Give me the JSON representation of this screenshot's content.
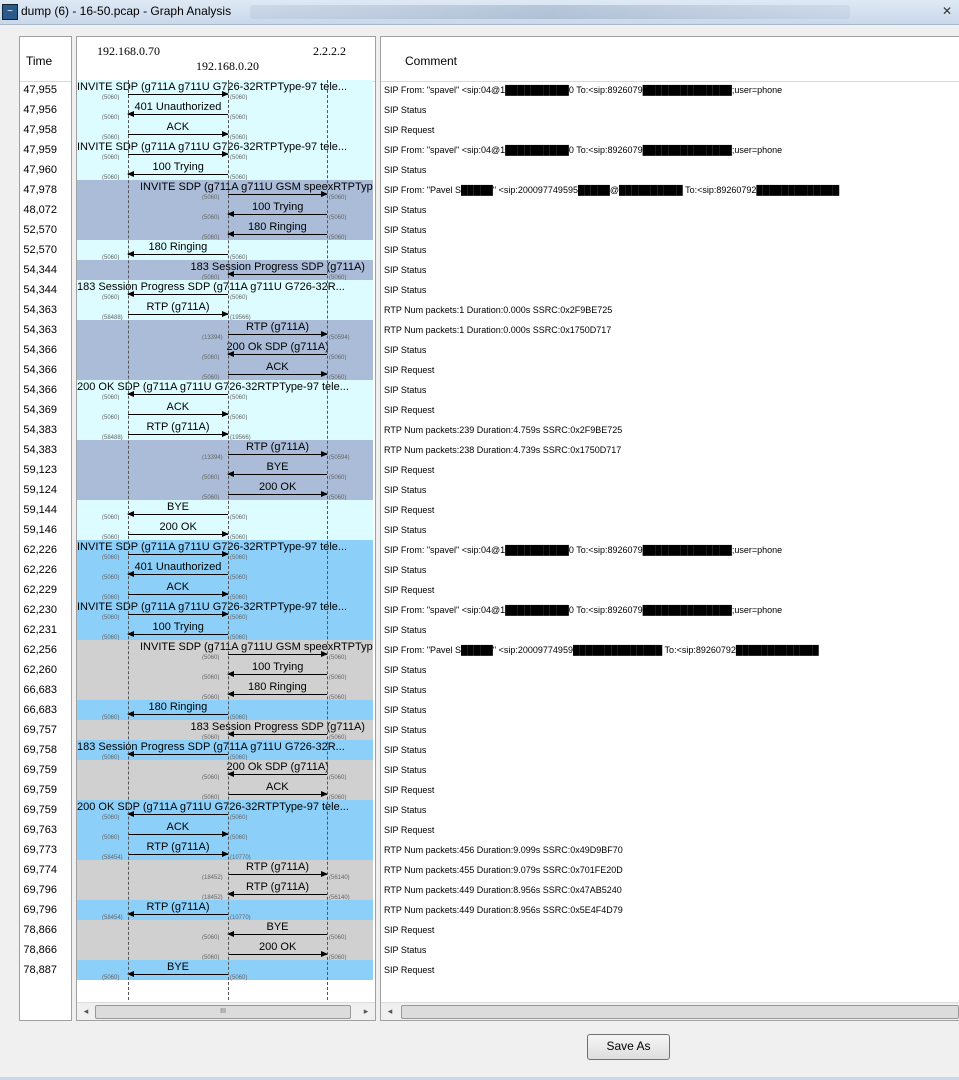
{
  "window": {
    "title": "dump (6) - 16-50.pcap - Graph Analysis",
    "app_icon": "wireshark-icon"
  },
  "columns": {
    "time": "Time",
    "comment": "Comment"
  },
  "nodes": [
    {
      "label": "192.168.0.70"
    },
    {
      "label": "192.168.0.20"
    },
    {
      "label": "2.2.2.2"
    }
  ],
  "colors": {
    "cyan": "#dcfcff",
    "slate": "#aabcd8",
    "sky": "#8cd0fa",
    "gray": "#d0d0d0"
  },
  "rows": [
    {
      "time": "47,955",
      "label": "INVITE SDP (g711A g711U G726-32RTPType-97 tele...",
      "from": 0,
      "to": 1,
      "band": "cyan",
      "p1": "(5060)",
      "p2": "(5060)",
      "comment": "SIP From: \"spavel\" <sip:04@1██████████0 To:<sip:8926079██████████████;user=phone"
    },
    {
      "time": "47,956",
      "label": "401 Unauthorized",
      "from": 1,
      "to": 0,
      "band": "cyan",
      "p1": "(5060)",
      "p2": "(5060)",
      "comment": "SIP Status"
    },
    {
      "time": "47,958",
      "label": "ACK",
      "from": 0,
      "to": 1,
      "band": "cyan",
      "p1": "(5060)",
      "p2": "(5060)",
      "comment": "SIP Request"
    },
    {
      "time": "47,959",
      "label": "INVITE SDP (g711A g711U G726-32RTPType-97 tele...",
      "from": 0,
      "to": 1,
      "band": "cyan",
      "p1": "(5060)",
      "p2": "(5060)",
      "comment": "SIP From: \"spavel\" <sip:04@1██████████0 To:<sip:8926079██████████████;user=phone"
    },
    {
      "time": "47,960",
      "label": "100 Trying",
      "from": 1,
      "to": 0,
      "band": "cyan",
      "p1": "(5060)",
      "p2": "(5060)",
      "comment": "SIP Status"
    },
    {
      "time": "47,978",
      "label": "INVITE SDP (g711A g711U GSM speexRTPTyp",
      "from": 1,
      "to": 2,
      "band": "slate",
      "p1": "(5060)",
      "p2": "(5060)",
      "comment": "SIP From: \"Pavel S█████\" <sip:200097749595█████@██████████ To:<sip:89260792█████████████"
    },
    {
      "time": "48,072",
      "label": "100 Trying",
      "from": 2,
      "to": 1,
      "band": "slate",
      "p1": "(5060)",
      "p2": "(5060)",
      "comment": "SIP Status"
    },
    {
      "time": "52,570",
      "label": "180 Ringing",
      "from": 2,
      "to": 1,
      "band": "slate",
      "p1": "(5060)",
      "p2": "(5060)",
      "comment": "SIP Status"
    },
    {
      "time": "52,570",
      "label": "180 Ringing",
      "from": 1,
      "to": 0,
      "band": "cyan",
      "p1": "(5060)",
      "p2": "(5060)",
      "comment": "SIP Status"
    },
    {
      "time": "54,344",
      "label": "183 Session Progress SDP (g711A)",
      "from": 2,
      "to": 1,
      "band": "slate",
      "p1": "(5060)",
      "p2": "(5060)",
      "comment": "SIP Status"
    },
    {
      "time": "54,344",
      "label": "183 Session Progress SDP (g711A g711U G726-32R...",
      "from": 1,
      "to": 0,
      "band": "cyan",
      "p1": "(5060)",
      "p2": "(5060)",
      "comment": "SIP Status"
    },
    {
      "time": "54,363",
      "label": "RTP (g711A)",
      "from": 0,
      "to": 1,
      "band": "cyan",
      "p1": "(58488)",
      "p2": "(19566)",
      "comment": "RTP Num packets:1  Duration:0.000s SSRC:0x2F9BE725"
    },
    {
      "time": "54,363",
      "label": "RTP (g711A)",
      "from": 1,
      "to": 2,
      "band": "slate",
      "p1": "(13394)",
      "p2": "(50594)",
      "comment": "RTP Num packets:1  Duration:0.000s SSRC:0x1750D717"
    },
    {
      "time": "54,366",
      "label": "200 Ok SDP (g711A)",
      "from": 2,
      "to": 1,
      "band": "slate",
      "p1": "(5060)",
      "p2": "(5060)",
      "comment": "SIP Status"
    },
    {
      "time": "54,366",
      "label": "ACK",
      "from": 1,
      "to": 2,
      "band": "slate",
      "p1": "(5060)",
      "p2": "(5060)",
      "comment": "SIP Request"
    },
    {
      "time": "54,366",
      "label": "200 OK SDP (g711A g711U G726-32RTPType-97 tele...",
      "from": 1,
      "to": 0,
      "band": "cyan",
      "p1": "(5060)",
      "p2": "(5060)",
      "comment": "SIP Status"
    },
    {
      "time": "54,369",
      "label": "ACK",
      "from": 0,
      "to": 1,
      "band": "cyan",
      "p1": "(5060)",
      "p2": "(5060)",
      "comment": "SIP Request"
    },
    {
      "time": "54,383",
      "label": "RTP (g711A)",
      "from": 0,
      "to": 1,
      "band": "cyan",
      "p1": "(58488)",
      "p2": "(19566)",
      "comment": "RTP Num packets:239  Duration:4.759s SSRC:0x2F9BE725"
    },
    {
      "time": "54,383",
      "label": "RTP (g711A)",
      "from": 1,
      "to": 2,
      "band": "slate",
      "p1": "(13394)",
      "p2": "(50594)",
      "comment": "RTP Num packets:238  Duration:4.739s SSRC:0x1750D717"
    },
    {
      "time": "59,123",
      "label": "BYE",
      "from": 2,
      "to": 1,
      "band": "slate",
      "p1": "(5060)",
      "p2": "(5060)",
      "comment": "SIP Request"
    },
    {
      "time": "59,124",
      "label": "200 OK",
      "from": 1,
      "to": 2,
      "band": "slate",
      "p1": "(5060)",
      "p2": "(5060)",
      "comment": "SIP Status"
    },
    {
      "time": "59,144",
      "label": "BYE",
      "from": 1,
      "to": 0,
      "band": "cyan",
      "p1": "(5060)",
      "p2": "(5060)",
      "comment": "SIP Request"
    },
    {
      "time": "59,146",
      "label": "200 OK",
      "from": 0,
      "to": 1,
      "band": "cyan",
      "p1": "(5060)",
      "p2": "(5060)",
      "comment": "SIP Status"
    },
    {
      "time": "62,226",
      "label": "INVITE SDP (g711A g711U G726-32RTPType-97 tele...",
      "from": 0,
      "to": 1,
      "band": "sky",
      "p1": "(5060)",
      "p2": "(5060)",
      "comment": "SIP From: \"spavel\" <sip:04@1██████████0 To:<sip:8926079██████████████;user=phone"
    },
    {
      "time": "62,226",
      "label": "401 Unauthorized",
      "from": 1,
      "to": 0,
      "band": "sky",
      "p1": "(5060)",
      "p2": "(5060)",
      "comment": "SIP Status"
    },
    {
      "time": "62,229",
      "label": "ACK",
      "from": 0,
      "to": 1,
      "band": "sky",
      "p1": "(5060)",
      "p2": "(5060)",
      "comment": "SIP Request"
    },
    {
      "time": "62,230",
      "label": "INVITE SDP (g711A g711U G726-32RTPType-97 tele...",
      "from": 0,
      "to": 1,
      "band": "sky",
      "p1": "(5060)",
      "p2": "(5060)",
      "comment": "SIP From: \"spavel\" <sip:04@1██████████0 To:<sip:8926079██████████████;user=phone"
    },
    {
      "time": "62,231",
      "label": "100 Trying",
      "from": 1,
      "to": 0,
      "band": "sky",
      "p1": "(5060)",
      "p2": "(5060)",
      "comment": "SIP Status"
    },
    {
      "time": "62,256",
      "label": "INVITE SDP (g711A g711U GSM speexRTPTyp",
      "from": 1,
      "to": 2,
      "band": "gray",
      "p1": "(5060)",
      "p2": "(5060)",
      "comment": "SIP From: \"Pavel S█████\" <sip:20009774959██████████████ To:<sip:89260792█████████████"
    },
    {
      "time": "62,260",
      "label": "100 Trying",
      "from": 2,
      "to": 1,
      "band": "gray",
      "p1": "(5060)",
      "p2": "(5060)",
      "comment": "SIP Status"
    },
    {
      "time": "66,683",
      "label": "180 Ringing",
      "from": 2,
      "to": 1,
      "band": "gray",
      "p1": "(5060)",
      "p2": "(5060)",
      "comment": "SIP Status"
    },
    {
      "time": "66,683",
      "label": "180 Ringing",
      "from": 1,
      "to": 0,
      "band": "sky",
      "p1": "(5060)",
      "p2": "(5060)",
      "comment": "SIP Status"
    },
    {
      "time": "69,757",
      "label": "183 Session Progress SDP (g711A)",
      "from": 2,
      "to": 1,
      "band": "gray",
      "p1": "(5060)",
      "p2": "(5060)",
      "comment": "SIP Status"
    },
    {
      "time": "69,758",
      "label": "183 Session Progress SDP (g711A g711U G726-32R...",
      "from": 1,
      "to": 0,
      "band": "sky",
      "p1": "(5060)",
      "p2": "(5060)",
      "comment": "SIP Status"
    },
    {
      "time": "69,759",
      "label": "200 Ok SDP (g711A)",
      "from": 2,
      "to": 1,
      "band": "gray",
      "p1": "(5060)",
      "p2": "(5060)",
      "comment": "SIP Status"
    },
    {
      "time": "69,759",
      "label": "ACK",
      "from": 1,
      "to": 2,
      "band": "gray",
      "p1": "(5060)",
      "p2": "(5060)",
      "comment": "SIP Request"
    },
    {
      "time": "69,759",
      "label": "200 OK SDP (g711A g711U G726-32RTPType-97 tele...",
      "from": 1,
      "to": 0,
      "band": "sky",
      "p1": "(5060)",
      "p2": "(5060)",
      "comment": "SIP Status"
    },
    {
      "time": "69,763",
      "label": "ACK",
      "from": 0,
      "to": 1,
      "band": "sky",
      "p1": "(5060)",
      "p2": "(5060)",
      "comment": "SIP Request"
    },
    {
      "time": "69,773",
      "label": "RTP (g711A)",
      "from": 0,
      "to": 1,
      "band": "sky",
      "p1": "(58454)",
      "p2": "(10770)",
      "comment": "RTP Num packets:456  Duration:9.099s SSRC:0x49D9BF70"
    },
    {
      "time": "69,774",
      "label": "RTP (g711A)",
      "from": 1,
      "to": 2,
      "band": "gray",
      "p1": "(18452)",
      "p2": "(56140)",
      "comment": "RTP Num packets:455  Duration:9.079s SSRC:0x701FE20D"
    },
    {
      "time": "69,796",
      "label": "RTP (g711A)",
      "from": 2,
      "to": 1,
      "band": "gray",
      "p1": "(18452)",
      "p2": "(56140)",
      "comment": "RTP Num packets:449  Duration:8.956s SSRC:0x47AB5240"
    },
    {
      "time": "69,796",
      "label": "RTP (g711A)",
      "from": 1,
      "to": 0,
      "band": "sky",
      "p1": "(58454)",
      "p2": "(10770)",
      "comment": "RTP Num packets:449  Duration:8.956s SSRC:0x5E4F4D79"
    },
    {
      "time": "78,866",
      "label": "BYE",
      "from": 2,
      "to": 1,
      "band": "gray",
      "p1": "(5060)",
      "p2": "(5060)",
      "comment": "SIP Request"
    },
    {
      "time": "78,866",
      "label": "200 OK",
      "from": 1,
      "to": 2,
      "band": "gray",
      "p1": "(5060)",
      "p2": "(5060)",
      "comment": "SIP Status"
    },
    {
      "time": "78,887",
      "label": "BYE",
      "from": 1,
      "to": 0,
      "band": "sky",
      "p1": "(5060)",
      "p2": "(5060)",
      "comment": "SIP Request"
    }
  ],
  "scrollbar": {
    "thumb_grip": "III",
    "left_arrow": "◂",
    "right_arrow": "▸"
  },
  "buttons": {
    "save_as": "Save As"
  }
}
